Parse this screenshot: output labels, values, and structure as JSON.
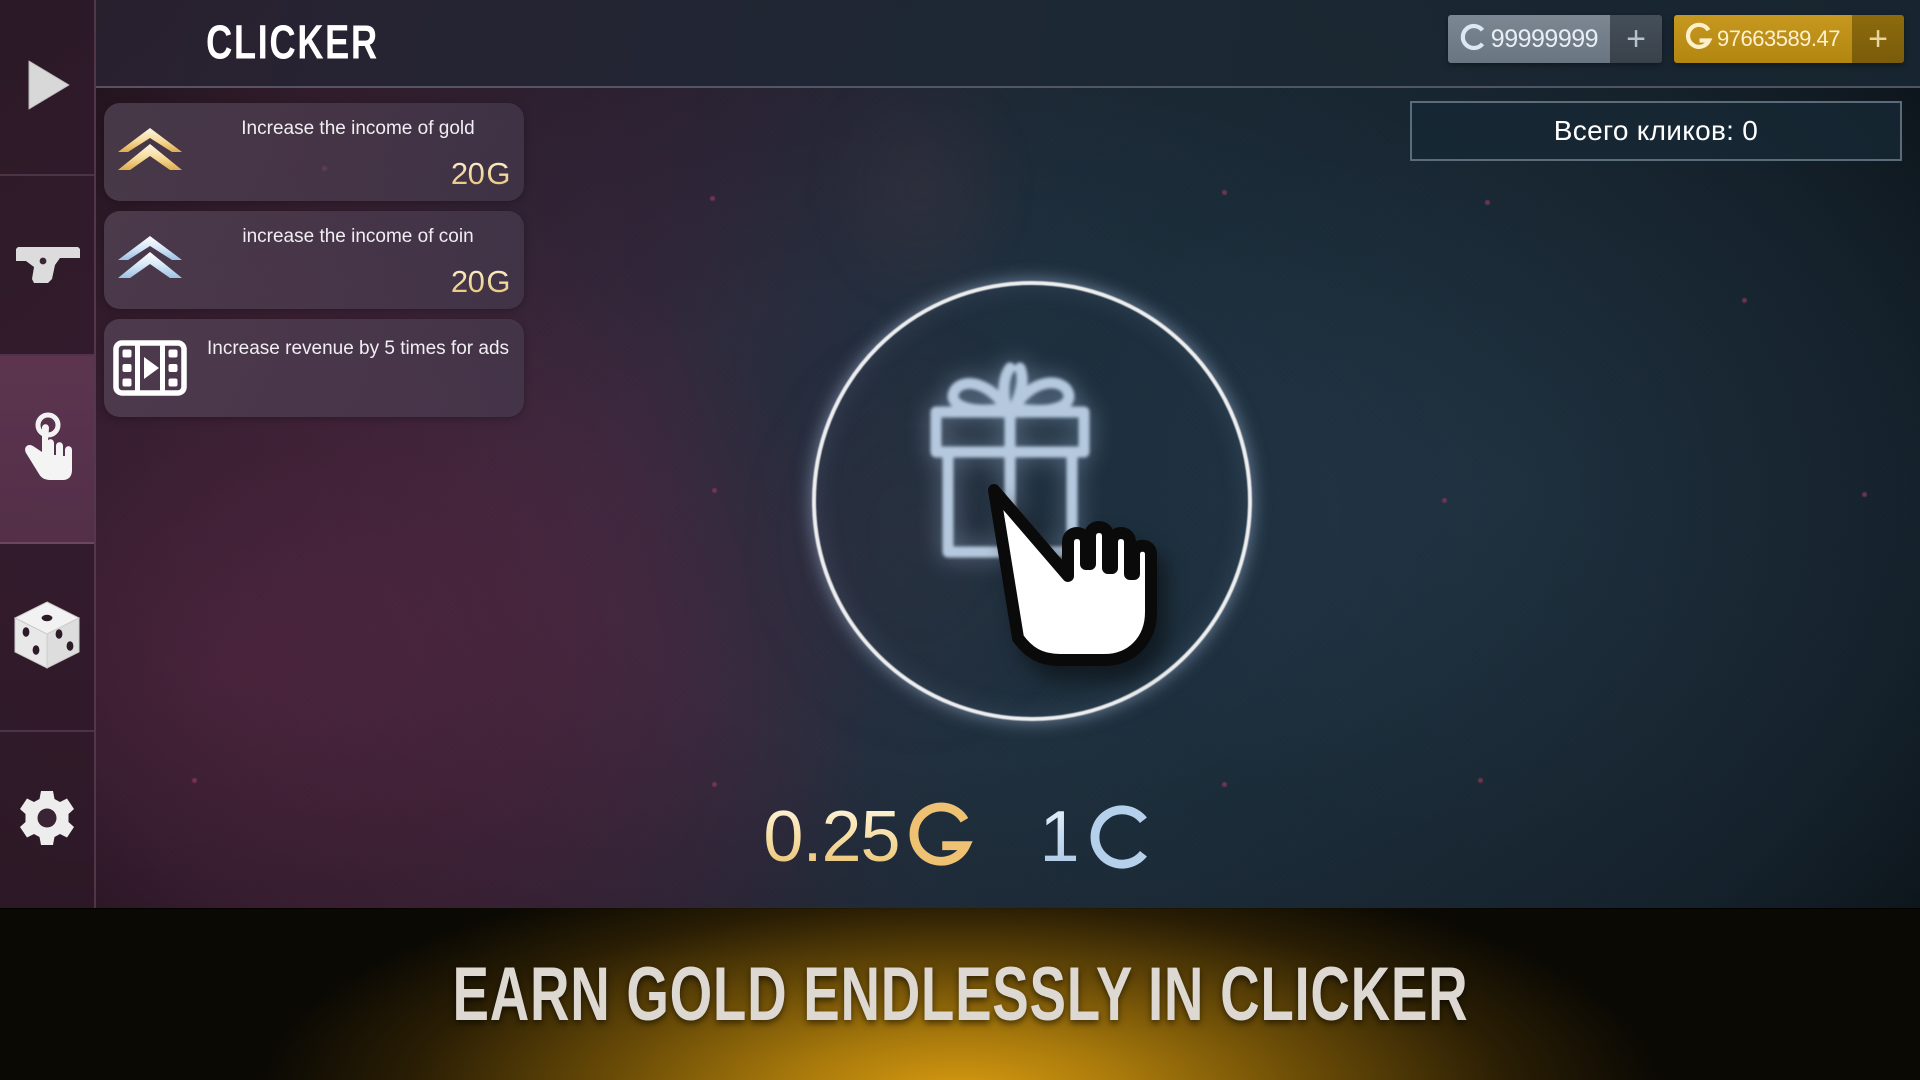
{
  "header": {
    "title": "CLICKER"
  },
  "currencies": [
    {
      "id": "coin",
      "symbol_name": "coin-symbol",
      "symbol": "C",
      "value": "99999999",
      "add_label": "+",
      "color": "#7c8792"
    },
    {
      "id": "gold",
      "symbol_name": "gold-symbol",
      "symbol": "G",
      "value": "97663589.47",
      "add_label": "+",
      "color": "#c79820"
    }
  ],
  "stats": {
    "clicks_label": "Всего кликов: 0"
  },
  "sidebar": {
    "items": [
      {
        "id": "play",
        "icon": "play-icon",
        "active": false
      },
      {
        "id": "weapons",
        "icon": "pistol-icon",
        "active": false
      },
      {
        "id": "clicker",
        "icon": "tap-hand-icon",
        "active": true
      },
      {
        "id": "dice",
        "icon": "dice-icon",
        "active": false
      },
      {
        "id": "settings",
        "icon": "gear-icon",
        "active": false
      }
    ]
  },
  "upgrades": [
    {
      "id": "gold-income",
      "icon": "chevron-up-gold-icon",
      "label": "Increase the income of gold",
      "cost_amount": "20",
      "cost_currency": "G",
      "two_line": false
    },
    {
      "id": "coin-income",
      "icon": "chevron-up-blue-icon",
      "label": "increase the income of coin",
      "cost_amount": "20",
      "cost_currency": "G",
      "two_line": false
    },
    {
      "id": "ads-boost",
      "icon": "video-ad-icon",
      "label": "Increase revenue by 5 times for ads",
      "cost_amount": "",
      "cost_currency": "",
      "two_line": true
    }
  ],
  "clicker": {
    "target_icon": "gift-box-icon",
    "cursor_icon": "pointing-hand-cursor-icon",
    "rewards": [
      {
        "id": "gold-reward",
        "amount": "0.25",
        "currency": "G"
      },
      {
        "id": "coin-reward",
        "amount": "1",
        "currency": "C"
      }
    ]
  },
  "banner": {
    "text": "EARN GOLD ENDLESSLY IN CLICKER"
  }
}
